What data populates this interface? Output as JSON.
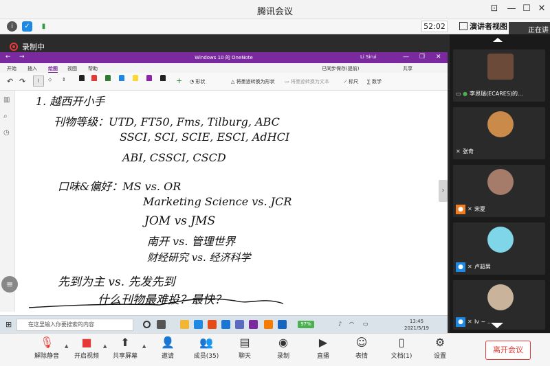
{
  "window": {
    "title": "腾讯会议"
  },
  "infobar": {
    "timer": "52:02",
    "presenter_view": "演讲者视图",
    "sharing": "正在讲"
  },
  "recording": {
    "label": "录制中"
  },
  "onenote": {
    "title": "Windows 10 的 OneNote",
    "user": "Li Sirui",
    "tabs": [
      "开始",
      "插入",
      "绘图",
      "视图",
      "帮助"
    ],
    "active_tab": "绘图",
    "status": "已同步保存(提前)",
    "share": "共享",
    "ribbon": {
      "shapes": "形状",
      "ink_to_shape": "将墨迹转换为形状",
      "ink_to_text": "将墨迹转换为文本",
      "ruler": "标尺",
      "math": "数学"
    },
    "pen_colors": [
      "#222222",
      "#e53935",
      "#2e7d32",
      "#1e88e5",
      "#fdd835",
      "#8e24aa",
      "#222222"
    ]
  },
  "handwriting": {
    "l1": "1. 越西开小手",
    "l2": "刊物等级：UTD, FT50, Fms, Tilburg, ABC",
    "l3": "SSCI, SCI, SCIE, ESCI, AdHCI",
    "l4": "ABI, CSSCI, CSCD",
    "l5": "口味&偏好：MS vs. OR",
    "l6": "Marketing Science vs. JCR",
    "l7": "JOM vs JMS",
    "l8": "南开 vs. 管理世界",
    "l9": "财经研究 vs. 经济科学",
    "l10": "先到为主 vs. 先发先到",
    "l11": "什么刊物最难投？最快？"
  },
  "taskbar": {
    "search_placeholder": "在这里输入你要搜索的内容",
    "battery": "97%",
    "time": "13:45",
    "date": "2021/5/19"
  },
  "participants": [
    {
      "name": "李思瑞(ECARES)的...",
      "photo_color": "#6b4a3a"
    },
    {
      "name": "张奇",
      "photo_color": "#c98a4a"
    },
    {
      "name": "宋夏",
      "photo_color": "#a57b6a"
    },
    {
      "name": "卢超男",
      "photo_color": "#7fd6e8"
    },
    {
      "name": "Iv ~ ...",
      "photo_color": "#c9b39a"
    }
  ],
  "toolbar": {
    "unmute": "解除静音",
    "start_video": "开启视频",
    "share_screen": "共享屏幕",
    "invite": "邀请",
    "members": "成员(35)",
    "chat": "聊天",
    "record": "录制",
    "live": "直播",
    "reactions": "表情",
    "docs": "文档(1)",
    "settings": "设置",
    "leave": "离开会议"
  }
}
